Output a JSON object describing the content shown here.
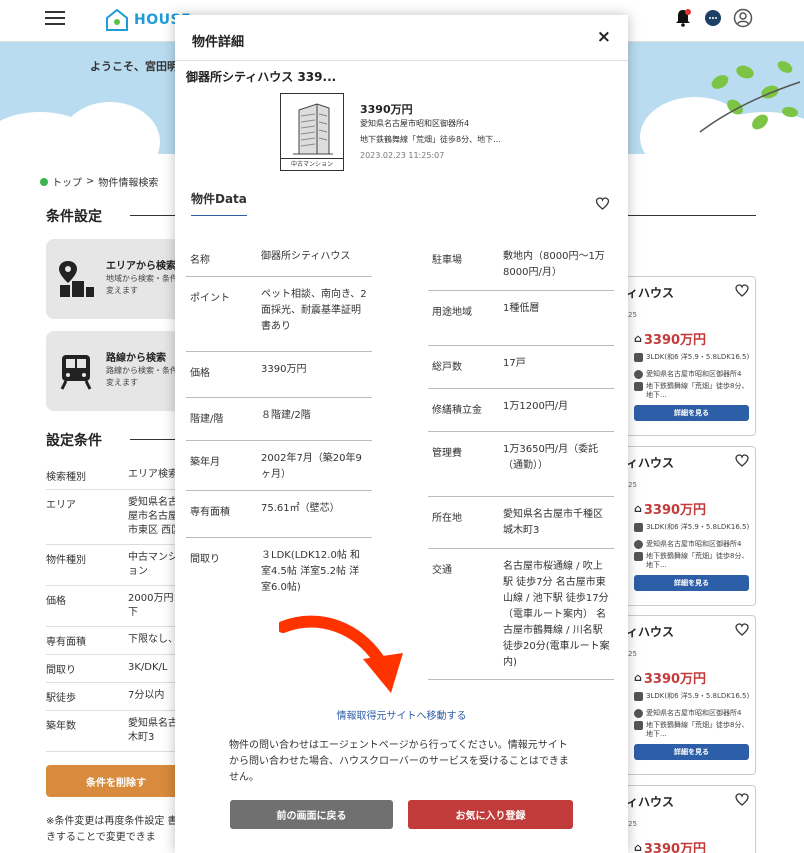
{
  "header": {
    "logo_text": "HOUSE",
    "icons": [
      "menu-icon",
      "notification-bell-icon",
      "chat-icon",
      "user-icon"
    ]
  },
  "banner": {
    "welcome": "ようこそ、宮田明"
  },
  "breadcrumb": {
    "top": "トップ",
    "sep": ">",
    "current": "物件情報検索"
  },
  "conditions": {
    "title": "条件設定",
    "area": {
      "title": "エリアから検索",
      "sub": "地域から検索・条件を変えます"
    },
    "line": {
      "title": "路線から検索",
      "sub": "路線から検索・条件を変えます"
    }
  },
  "settings": {
    "title": "設定条件",
    "rows": [
      {
        "k": "検索種別",
        "v": "エリア検索"
      },
      {
        "k": "エリア",
        "v": "愛知県名古屋市名古屋市東区 西区"
      },
      {
        "k": "物件種別",
        "v": "中古マンション"
      },
      {
        "k": "価格",
        "v": "2000万円 下"
      },
      {
        "k": "専有面積",
        "v": "下限なし、"
      },
      {
        "k": "間取り",
        "v": "3K/DK/L"
      },
      {
        "k": "駅徒歩",
        "v": "7分以内"
      },
      {
        "k": "築年数",
        "v": "愛知県名古 木町3"
      }
    ],
    "delete_button": "条件を削除す",
    "note": "※条件変更は再度条件設定 書きすることで変更できま"
  },
  "result_cards": [
    {
      "name": "ィハウス",
      "small": "25",
      "price": "3390万円",
      "layout": "3LDK(和6 洋5.9・5.8LDK16.5)",
      "addr": "愛知県名古屋市昭和区御器所4",
      "access": "地下鉄鶴舞線「荒畑」徒歩8分、地下...",
      "button": "詳細を見る"
    },
    {
      "name": "ィハウス",
      "small": "25",
      "price": "3390万円",
      "layout": "3LDK(和6 洋5.9・5.8LDK16.5)",
      "addr": "愛知県名古屋市昭和区御器所4",
      "access": "地下鉄鶴舞線「荒畑」徒歩8分、地下...",
      "button": "詳細を見る"
    },
    {
      "name": "ィハウス",
      "small": "25",
      "price": "3390万円",
      "layout": "3LDK(和6 洋5.9・5.8LDK16.5)",
      "addr": "愛知県名古屋市昭和区御器所4",
      "access": "地下鉄鶴舞線「荒畑」徒歩8分、地下...",
      "button": "詳細を見る"
    },
    {
      "name": "ィハウス",
      "small": "25",
      "price": "3390万円"
    }
  ],
  "modal": {
    "title": "物件詳細",
    "close": "×",
    "property_name": "御器所シティハウス 339...",
    "thumb_label": "中古マンション",
    "price": "3390万円",
    "address": "愛知県名古屋市昭和区御器所4",
    "access": "地下鉄鶴舞線「荒畑」徒歩8分、地下...",
    "date": "2023.02.23 11:25:07",
    "data_heading": "物件Data",
    "left": [
      {
        "k": "名称",
        "v": "御器所シティハウス"
      },
      {
        "k": "ポイント",
        "v": "ペット相談、南向き、2面採光、耐震基準証明書あり"
      },
      {
        "k": "価格",
        "v": "3390万円"
      },
      {
        "k": "階建/階",
        "v": "８階建/2階"
      },
      {
        "k": "築年月",
        "v": "2002年7月（築20年9ヶ月）"
      },
      {
        "k": "専有面積",
        "v": "75.61㎡（壁芯）"
      },
      {
        "k": "間取り",
        "v": "３LDK(LDK12.0帖 和室4.5帖 洋室5.2帖 洋室6.0帖)"
      }
    ],
    "right": [
      {
        "k": "駐車場",
        "v": "敷地内（8000円〜1万8000円/月）"
      },
      {
        "k": "用途地域",
        "v": "1種低層"
      },
      {
        "k": "総戸数",
        "v": "17戸"
      },
      {
        "k": "修繕積立金",
        "v": "1万1200円/月"
      },
      {
        "k": "管理費",
        "v": "1万3650円/月（委託（通勤））"
      },
      {
        "k": "所在地",
        "v": "愛知県名古屋市千種区城木町3"
      },
      {
        "k": "交通",
        "v": "名古屋市桜通線 / 吹上駅 徒歩7分 名古屋市東山線 / 池下駅 徒歩17分 （電車ルート案内） 名古屋市鶴舞線 / 川名駅 徒歩20分(電車ルート案内)"
      }
    ],
    "source_link": "情報取得元サイトへ移動する",
    "disclaimer": "物件の問い合わせはエージェントページから行ってください。情報元サイトから問い合わせた場合、ハウスクローバーのサービスを受けることはできません。",
    "back_button": "前の画面に戻る",
    "fav_button": "お気に入り登録"
  },
  "colors": {
    "accent_blue": "#2d5ea8",
    "price_red": "#c33a3a",
    "fav_red": "#c13b3b",
    "back_gray": "#707070",
    "arrow_red": "#ff3300"
  }
}
